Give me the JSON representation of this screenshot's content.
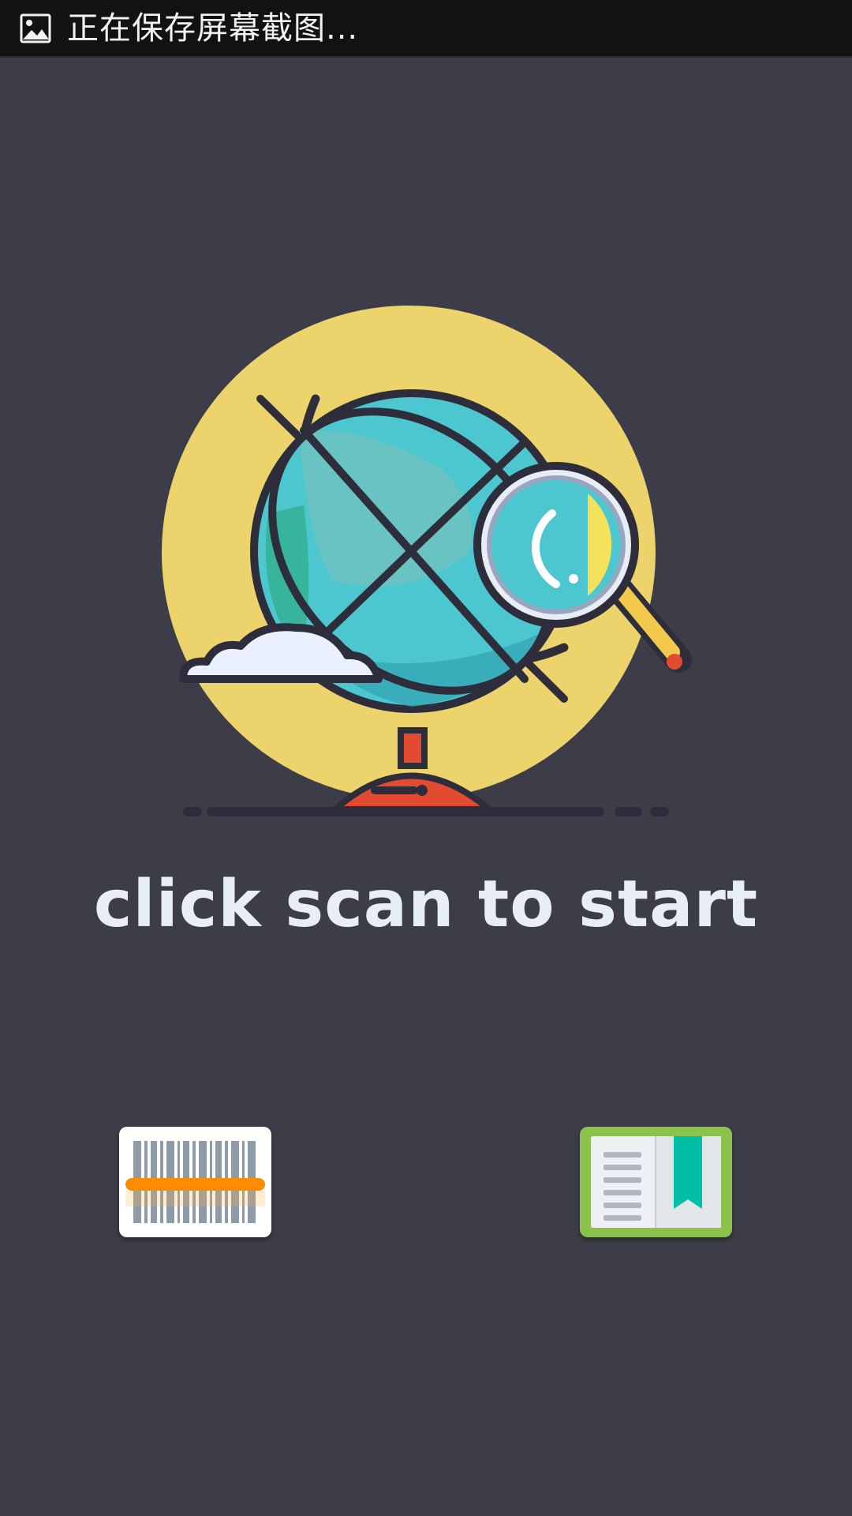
{
  "status_bar": {
    "notification_icon": "image-icon",
    "message": "正在保存屏幕截图..."
  },
  "main": {
    "illustration": "globe-magnifier-illustration",
    "headline": "click scan to start"
  },
  "buttons": {
    "scan": {
      "icon": "barcode-scan-icon"
    },
    "library": {
      "icon": "book-icon"
    }
  },
  "colors": {
    "background": "#3d3d49",
    "status_bar": "#121212",
    "sun_circle": "#ecd36c",
    "globe": "#4cc7cf",
    "stand": "#e24a31",
    "scan_line": "#ff8c00",
    "book_cover": "#8bc24a",
    "bookmark": "#00bfa5"
  }
}
